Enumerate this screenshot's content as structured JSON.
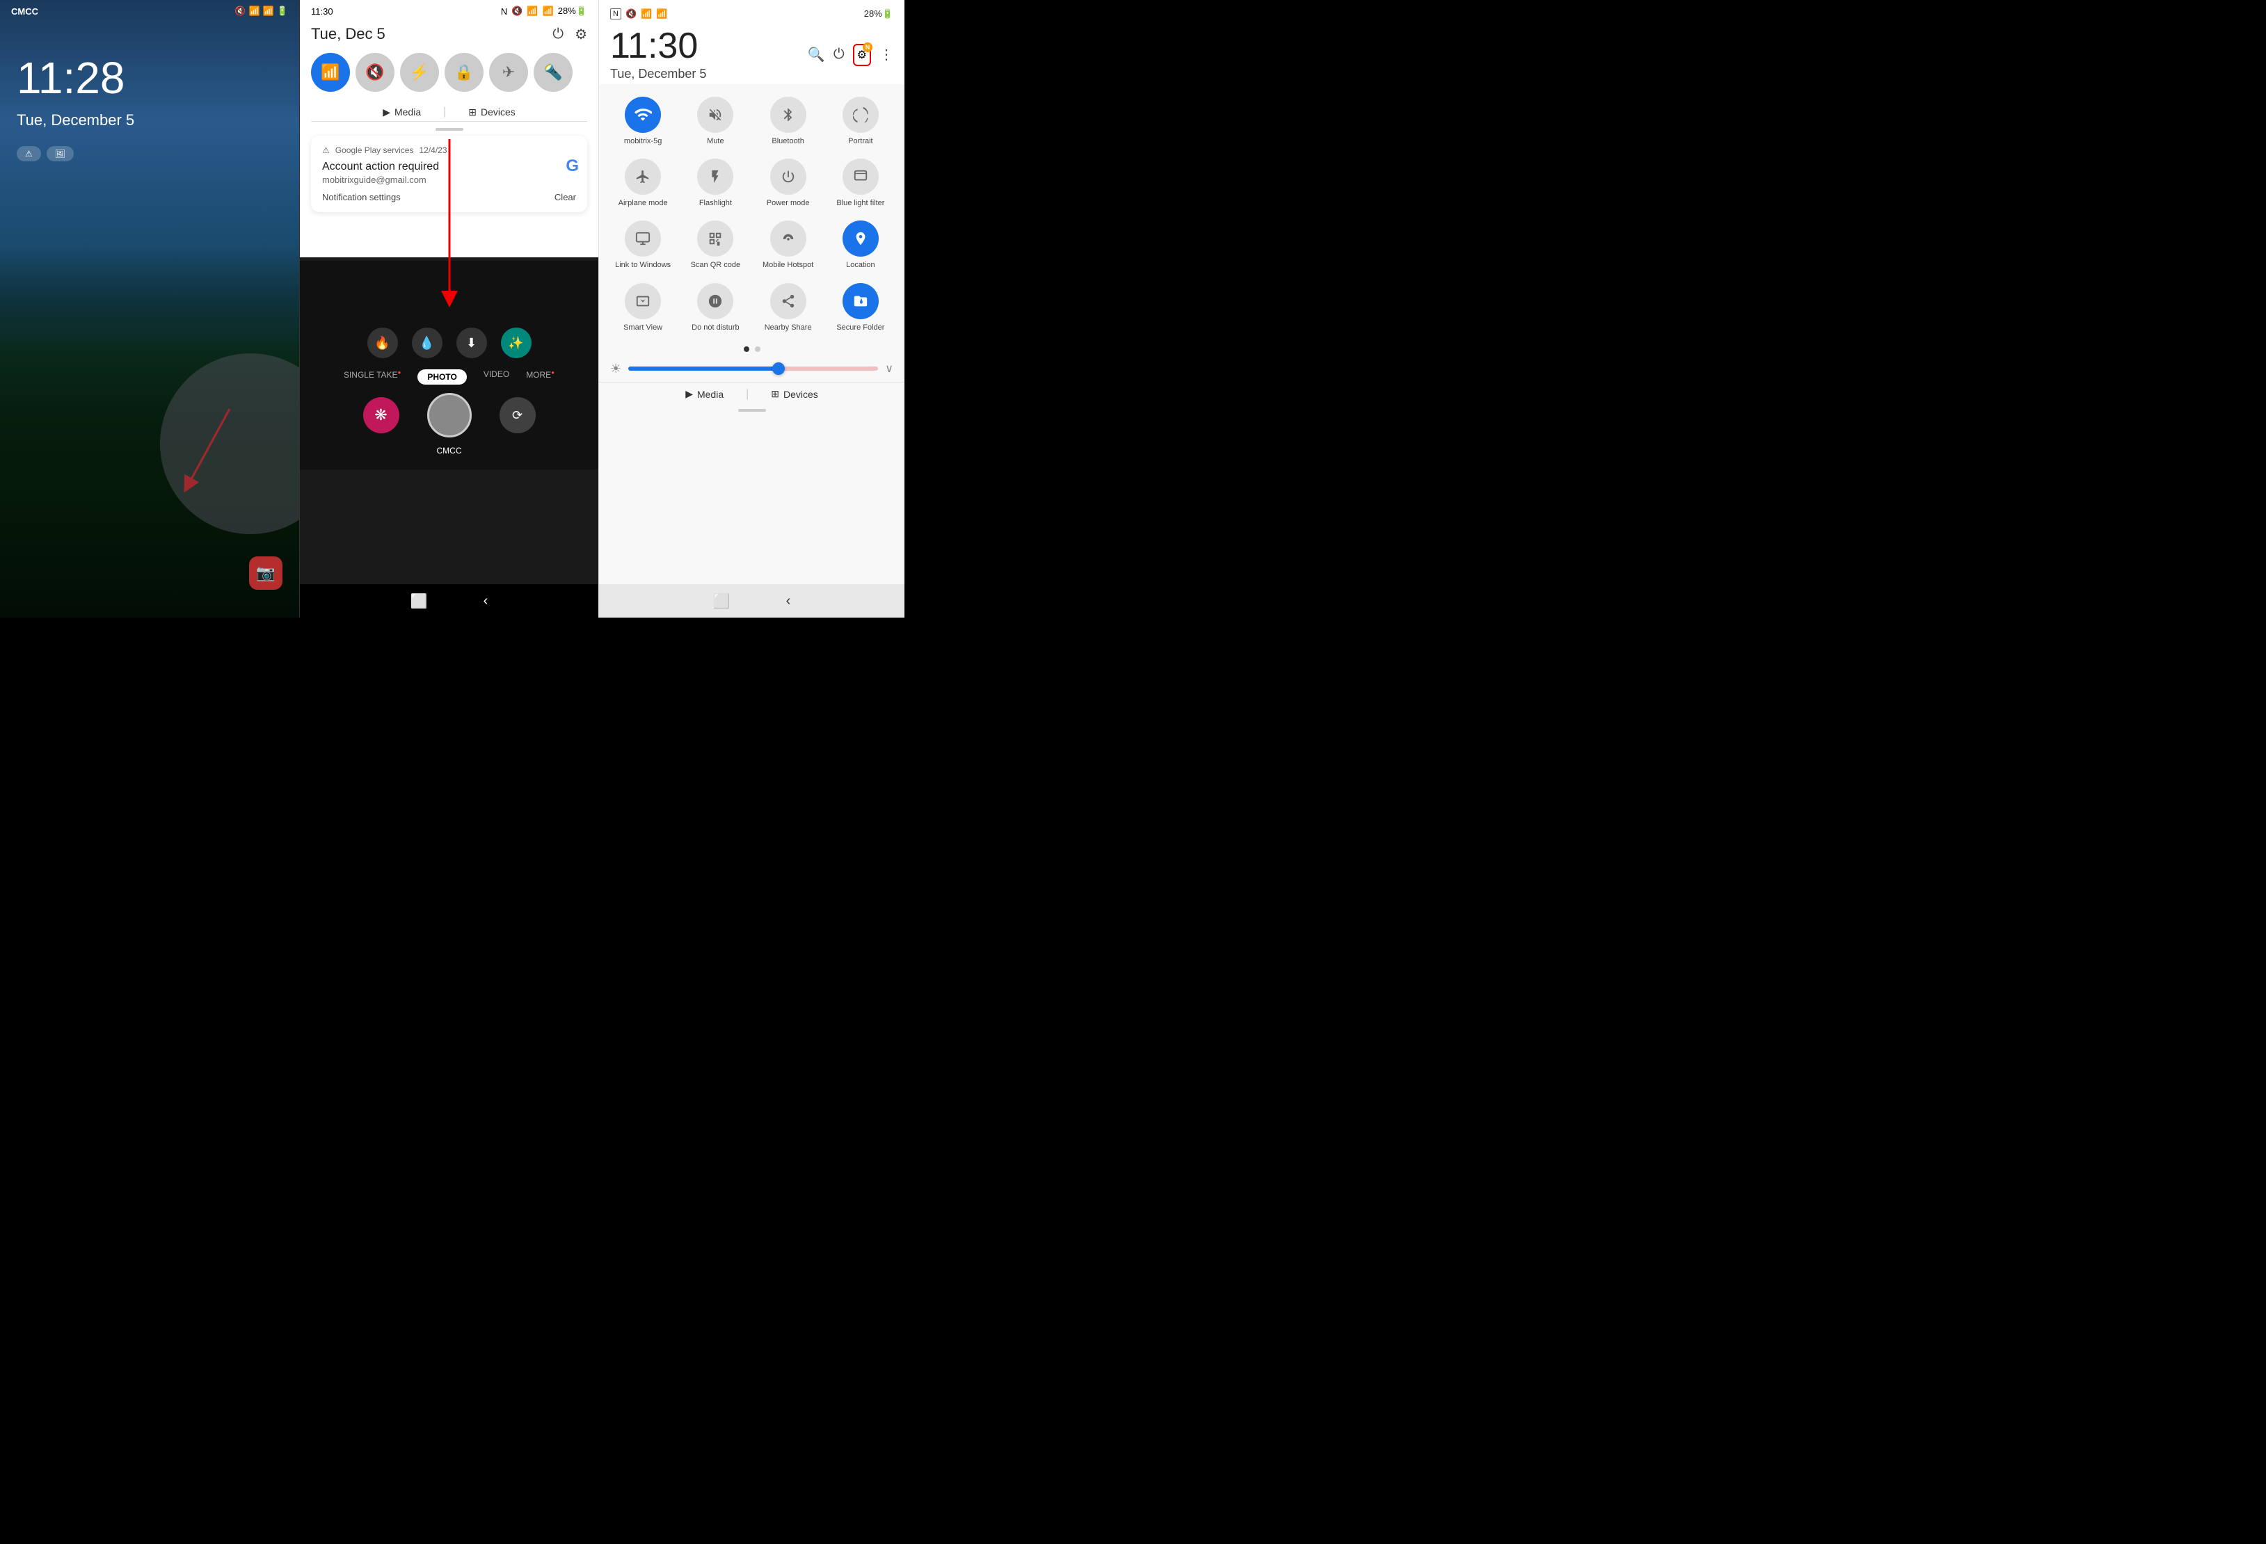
{
  "lock_screen": {
    "carrier": "CMCC",
    "time": "11:28",
    "date": "Tue, December 5",
    "shortcut1": "⚠",
    "shortcut2": "🖼"
  },
  "notif_panel": {
    "time": "11:30",
    "date": "Tue, Dec 5",
    "tiles": [
      {
        "label": "WiFi",
        "active": true
      },
      {
        "label": "Mute",
        "active": false
      },
      {
        "label": "Bluetooth",
        "active": false
      },
      {
        "label": "Portrait",
        "active": false
      },
      {
        "label": "Airplane",
        "active": false
      }
    ],
    "media_label": "Media",
    "devices_label": "Devices",
    "notification": {
      "source": "Google Play services",
      "date": "12/4/23",
      "title": "Account action required",
      "email": "mobitrixguide@gmail.com"
    },
    "notif_settings": "Notification settings",
    "clear": "Clear"
  },
  "camera": {
    "modes": [
      "SINGLE TAKE",
      "PHOTO",
      "VIDEO",
      "MORE"
    ],
    "active_mode": "PHOTO",
    "label": "CMCC"
  },
  "quick_settings": {
    "time": "11:30",
    "date": "Tue, December 5",
    "tiles": [
      {
        "id": "wifi",
        "label": "mobitrix-5g",
        "active": true,
        "icon": "📶"
      },
      {
        "id": "mute",
        "label": "Mute",
        "active": false,
        "icon": "🔇"
      },
      {
        "id": "bluetooth",
        "label": "Bluetooth",
        "active": false,
        "icon": "⚡"
      },
      {
        "id": "portrait",
        "label": "Portrait",
        "active": false,
        "icon": "🔒"
      },
      {
        "id": "airplane",
        "label": "Airplane mode",
        "active": false,
        "icon": "✈"
      },
      {
        "id": "flashlight",
        "label": "Flashlight",
        "active": false,
        "icon": "🔦"
      },
      {
        "id": "power-mode",
        "label": "Power mode",
        "active": false,
        "icon": "⚡"
      },
      {
        "id": "blue-light",
        "label": "Blue light filter",
        "active": false,
        "icon": "🅱"
      },
      {
        "id": "link-windows",
        "label": "Link to Windows",
        "active": false,
        "icon": "🖥"
      },
      {
        "id": "scan-qr",
        "label": "Scan QR code",
        "active": false,
        "icon": "⊞"
      },
      {
        "id": "mobile-hotspot",
        "label": "Mobile Hotspot",
        "active": false,
        "icon": "📡"
      },
      {
        "id": "location",
        "label": "Location",
        "active": true,
        "icon": "📍"
      },
      {
        "id": "smart-view",
        "label": "Smart View",
        "active": false,
        "icon": "⊙"
      },
      {
        "id": "do-not-disturb",
        "label": "Do not disturb",
        "active": false,
        "icon": "⊖"
      },
      {
        "id": "nearby-share",
        "label": "Nearby Share",
        "active": false,
        "icon": "↗"
      },
      {
        "id": "secure-folder",
        "label": "Secure Folder",
        "active": true,
        "icon": "🔐"
      }
    ],
    "media_label": "Media",
    "devices_label": "Devices"
  }
}
